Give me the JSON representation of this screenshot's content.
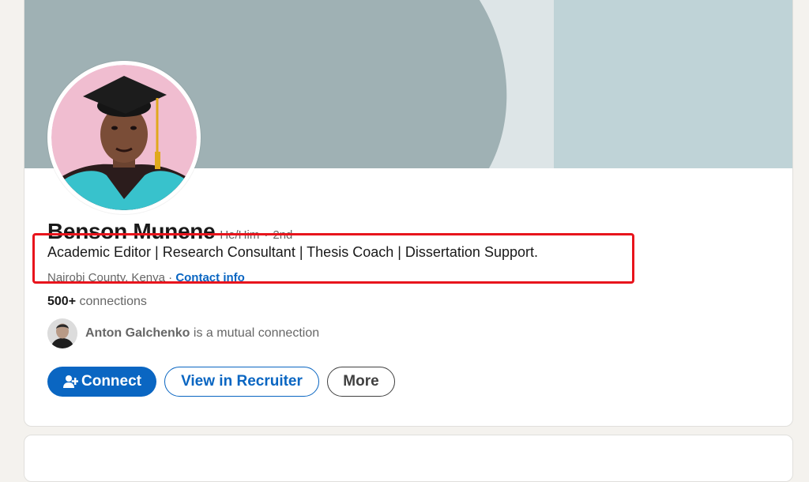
{
  "profile": {
    "name": "Benson Munene",
    "pronouns": "He/Him",
    "degree_separator": "·",
    "degree": "2nd",
    "headline": "Academic Editor | Research Consultant | Thesis Coach | Dissertation Support.",
    "location": "Nairobi County, Kenya",
    "location_separator": "·",
    "contact_info_label": "Contact info",
    "connections_count": "500+",
    "connections_label": "connections",
    "mutual": {
      "name": "Anton Galchenko",
      "text": "is a mutual connection"
    }
  },
  "actions": {
    "connect_label": "Connect",
    "recruiter_label": "View in Recruiter",
    "more_label": "More"
  },
  "icons": {
    "connect": "add-person-icon"
  },
  "colors": {
    "brand_blue": "#0a66c2",
    "highlight_red": "#e8141c",
    "banner_gray": "#9fb1b4",
    "banner_light": "#bfd3d7"
  }
}
